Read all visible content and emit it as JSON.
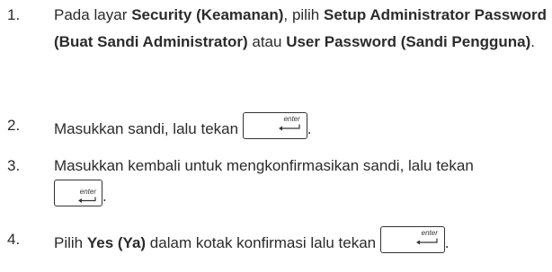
{
  "steps": [
    {
      "number": "1.",
      "parts": {
        "a": "Pada layar ",
        "b": "Security (Keamanan)",
        "c": ", pilih ",
        "d": "Setup Administrator Password (Buat Sandi Administrator)",
        "e": " atau ",
        "f": "User Password (Sandi Pengguna)",
        "g": "."
      }
    },
    {
      "number": "2.",
      "parts": {
        "a": "Masukkan sandi, lalu tekan ",
        "g": "."
      }
    },
    {
      "number": "3.",
      "parts": {
        "a": "Masukkan kembali untuk mengkonfirmasikan sandi, lalu tekan",
        "g": "."
      }
    },
    {
      "number": "4.",
      "parts": {
        "a": "Pilih ",
        "b": "Yes (Ya)",
        "c": " dalam kotak konfirmasi lalu tekan ",
        "g": "."
      }
    }
  ],
  "key": {
    "label": "enter",
    "icon": "enter-arrow-icon"
  }
}
